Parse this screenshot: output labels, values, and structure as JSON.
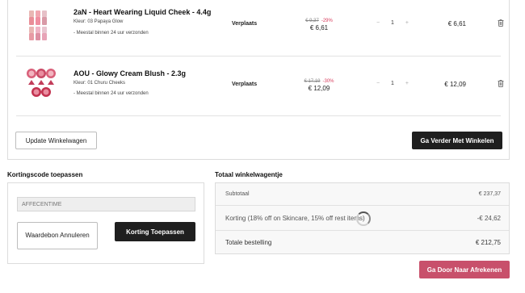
{
  "cart": {
    "items": [
      {
        "name": "2aN - Heart Wearing Liquid Cheek - 4.4g",
        "variant": "Kleur: 03 Papaya Glow",
        "shipping": "- Meestal binnen 24 uur verzonden",
        "status": "Verplaats",
        "old_price": "€ 9,37",
        "discount": "-29%",
        "price": "€ 6,61",
        "qty_minus": "−",
        "quantity": "1",
        "qty_plus": "+",
        "line_total": "€ 6,61"
      },
      {
        "name": "AOU - Glowy Cream Blush - 2.3g",
        "variant": "Kleur: 01 Churu Cheeks",
        "shipping": "- Meestal binnen 24 uur verzonden",
        "status": "Verplaats",
        "old_price": "€ 17,19",
        "discount": "-30%",
        "price": "€ 12,09",
        "qty_minus": "−",
        "quantity": "1",
        "qty_plus": "+",
        "line_total": "€ 12,09"
      }
    ],
    "update_label": "Update Winkelwagen",
    "continue_label": "Ga Verder Met Winkelen"
  },
  "coupon": {
    "title": "Kortingscode toepassen",
    "code_value": "AFFECENTIME",
    "cancel_label": "Waardebon Annuleren",
    "apply_label": "Korting Toepassen"
  },
  "totals": {
    "title": "Totaal winkelwagentje",
    "subtotal_label": "Subtotaal",
    "subtotal_value": "€ 237,37",
    "discount_label": "Korting (18% off on Skincare, 15% off rest items)",
    "discount_value": "-€ 24,62",
    "total_label": "Totale bestelling",
    "total_value": "€ 212,75"
  },
  "checkout_label": "Ga Door Naar Afrekenen",
  "icons": {
    "trash": "trash-icon",
    "spinner": "loading-spinner-icon"
  },
  "colors": {
    "primary_button": "#1f1f1f",
    "checkout_button": "#c8506b",
    "discount_text": "#d83c5c"
  }
}
